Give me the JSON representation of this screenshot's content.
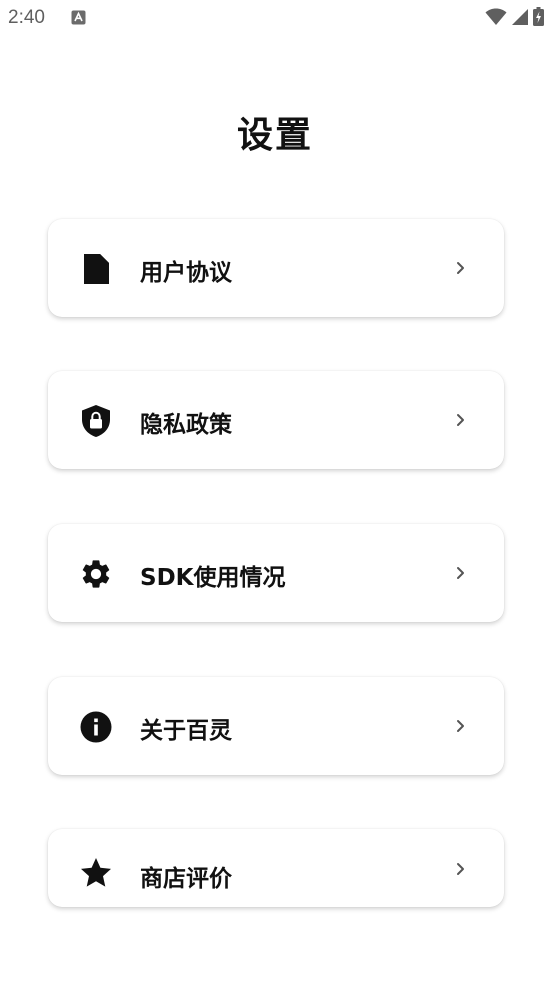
{
  "status_bar": {
    "time": "2:40",
    "notification_icon": "font-a-icon",
    "wifi_icon": "wifi-icon",
    "signal_icon": "cell-signal-icon",
    "battery_icon": "battery-charging-icon"
  },
  "header": {
    "title": "设置"
  },
  "settings": {
    "items": [
      {
        "label": "用户协议",
        "icon": "document-icon",
        "chevron": "chevron-right-icon"
      },
      {
        "label": "隐私政策",
        "icon": "shield-lock-icon",
        "chevron": "chevron-right-icon"
      },
      {
        "label": "SDK使用情况",
        "icon": "gear-icon",
        "chevron": "chevron-right-icon"
      },
      {
        "label": "关于百灵",
        "icon": "info-icon",
        "chevron": "chevron-right-icon"
      },
      {
        "label": "商店评价",
        "icon": "star-icon",
        "chevron": "chevron-right-icon"
      }
    ]
  },
  "colors": {
    "background": "#ffffff",
    "text": "#111111",
    "status_text": "#5f5f5f",
    "chevron": "#555555"
  }
}
